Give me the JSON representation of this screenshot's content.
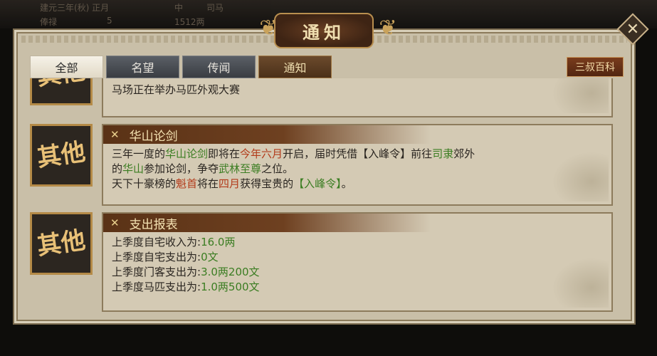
{
  "background": {
    "texts": [
      "建元三年(秋) 正月",
      "中",
      "司马",
      "俸禄",
      "5",
      "1512两"
    ]
  },
  "window": {
    "title": "通知",
    "close_label": "✕"
  },
  "tabs": [
    {
      "label": "全部",
      "state": "active"
    },
    {
      "label": "名望",
      "state": "normal"
    },
    {
      "label": "传闻",
      "state": "normal"
    },
    {
      "label": "通知",
      "state": "notice"
    }
  ],
  "wiki_button": "三叔百科",
  "items": [
    {
      "badge": "其他",
      "lines": [
        "马场正在举办马匹外观大赛"
      ]
    },
    {
      "badge": "其他",
      "title": "华山论剑",
      "line1": {
        "a": "三年一度的",
        "b": "华山论剑",
        "c": "即将在",
        "d": "今年六月",
        "e": "开启，届时凭借【入峰令】前往",
        "f": "司隶",
        "g": "郊外"
      },
      "line2": {
        "a": "的",
        "b": "华山",
        "c": "参加论剑，争夺",
        "d": "武林至尊",
        "e": "之位。"
      },
      "line3": {
        "a": "天下十豪榜的",
        "b": "魁首",
        "c": "将在",
        "d": "四月",
        "e": "获得宝贵的",
        "f": "【入峰令】",
        "g": "。"
      }
    },
    {
      "badge": "其他",
      "title": "支出报表",
      "rows": [
        {
          "label": "上季度自宅收入为:",
          "value": "16.0两"
        },
        {
          "label": "上季度自宅支出为:",
          "value": "0文"
        },
        {
          "label": "上季度门客支出为:",
          "value": "3.0两200文"
        },
        {
          "label": "上季度马匹支出为:",
          "value": "1.0两500文"
        }
      ]
    }
  ],
  "colors": {
    "highlight_green": "#3b7d22",
    "highlight_red": "#b23a1a",
    "card_title": "#f4e2b2"
  }
}
